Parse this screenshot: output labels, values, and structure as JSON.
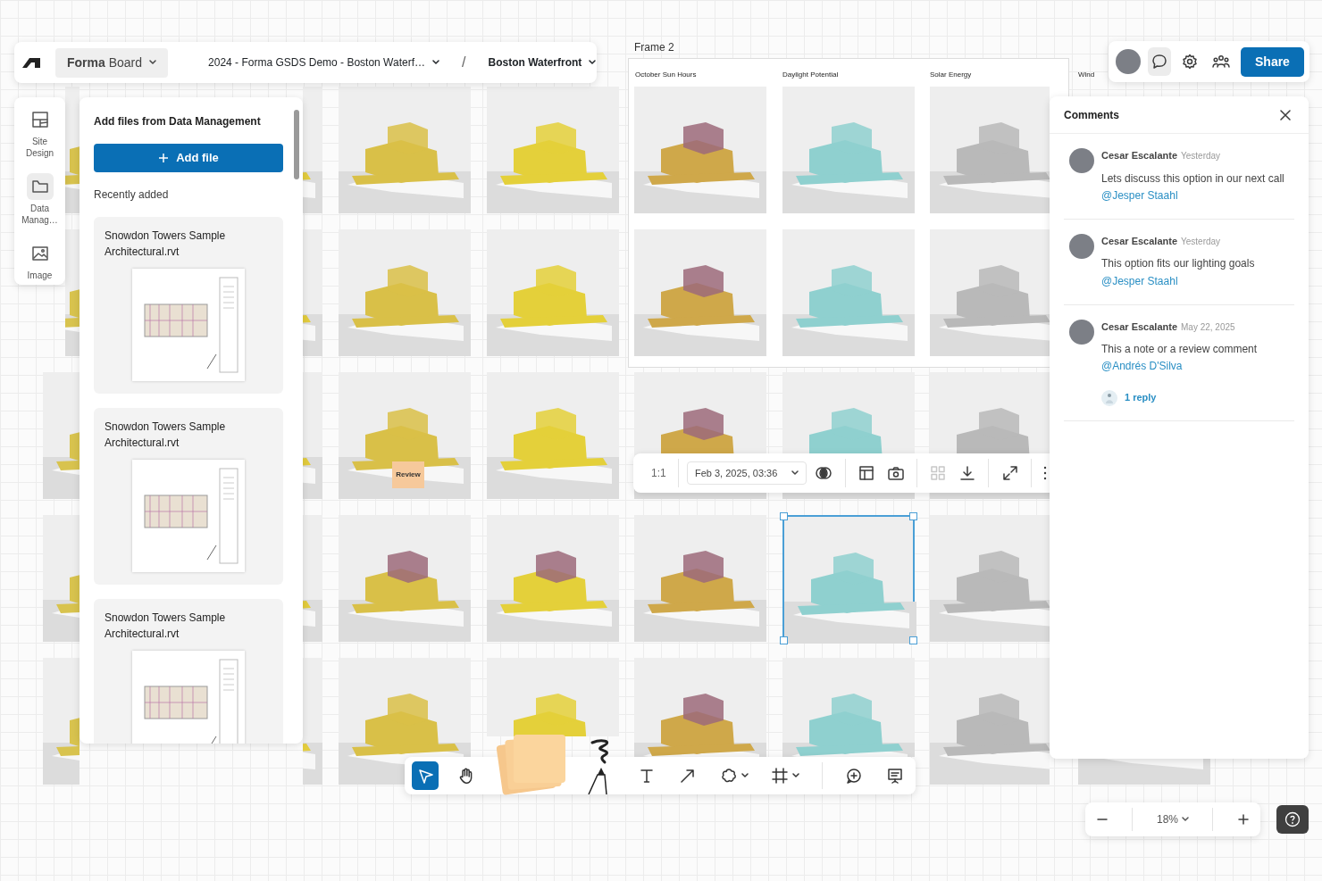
{
  "topbar": {
    "app_name": "**Forma** Board",
    "project": "2024 - Forma GSDS Demo - Boston Waterf…",
    "separator": "/",
    "site": "Boston Waterfront"
  },
  "top_actions": {
    "comments_open": true,
    "share_label": "Share"
  },
  "side_nav": [
    {
      "kind": "site",
      "label": "Site Design",
      "selected": false
    },
    {
      "kind": "folder",
      "label": "Data Manag…",
      "selected": true
    },
    {
      "kind": "image",
      "label": "Image",
      "selected": false
    }
  ],
  "files_panel": {
    "title": "Add files from Data Management",
    "add_button": "Add file",
    "section": "Recently added",
    "files": [
      {
        "name": "Snowdon Towers Sample Architectural.rvt"
      },
      {
        "name": "Snowdon Towers Sample Architectural.rvt"
      },
      {
        "name": "Snowdon Towers Sample Architectural.rvt"
      }
    ]
  },
  "canvas": {
    "frame_label": "Frame 2",
    "column_titles": [
      "October Sun Hours",
      "Daylight Potential",
      "Solar Energy",
      "Wind"
    ],
    "sticky_label": "Review",
    "tile_rows": [
      {
        "tiles": [
          {
            "selected": false
          },
          {
            "selected": false
          },
          {
            "selected": false
          },
          {
            "selected": false
          },
          {
            "selected": false
          },
          {
            "selected": false
          },
          {
            "selected": false
          }
        ]
      },
      {
        "tiles": [
          {
            "selected": false
          },
          {
            "selected": false
          },
          {
            "selected": false
          },
          {
            "selected": false
          },
          {
            "selected": false
          },
          {
            "selected": false
          },
          {
            "selected": false
          }
        ]
      },
      {
        "tiles": [
          {
            "selected": false
          },
          {
            "selected": false
          },
          {
            "selected": false
          },
          {
            "selected": false
          },
          {
            "selected": false
          },
          {
            "selected": false
          },
          {
            "selected": false
          }
        ]
      },
      {
        "tiles": [
          {
            "selected": false
          },
          {
            "selected": false
          },
          {
            "selected": false
          },
          {
            "selected": false
          },
          {
            "selected": false
          },
          {
            "selected": true
          },
          {
            "selected": false
          }
        ]
      },
      {
        "tiles": [
          {
            "selected": false
          },
          {
            "selected": false
          },
          {
            "selected": false
          },
          {
            "selected": false
          },
          {
            "selected": false
          },
          {
            "selected": false
          },
          {
            "selected": false
          },
          {
            "selected": false
          }
        ]
      }
    ]
  },
  "image_toolbar": {
    "scale": "1:1",
    "date": "Feb 3, 2025, 03:36",
    "tools": [
      {
        "kind": "contrast",
        "disabled": false
      },
      {
        "kind": "layout",
        "disabled": false
      },
      {
        "kind": "camera",
        "disabled": false
      },
      {
        "kind": "grid",
        "disabled": true
      },
      {
        "kind": "download",
        "disabled": false
      },
      {
        "kind": "expand",
        "disabled": false
      },
      {
        "kind": "more",
        "disabled": false
      }
    ]
  },
  "comments": {
    "title": "Comments",
    "items": [
      {
        "author": "Cesar Escalante",
        "time": "Yesterday",
        "text": "Lets discuss this option in our next call",
        "mention": "@Jesper Staahl"
      },
      {
        "author": "Cesar Escalante",
        "time": "Yesterday",
        "text": "This option fits our lighting goals",
        "mention": "@Jesper Staahl"
      },
      {
        "author": "Cesar Escalante",
        "time": "May 22, 2025",
        "text": "This a note or a review comment",
        "mention": "@Andrés D'Silva",
        "reply": "1 reply"
      }
    ]
  },
  "tools": [
    {
      "kind": "select",
      "selected": true
    },
    {
      "kind": "hand",
      "selected": false
    },
    {
      "kind": "sticky",
      "selected": false
    },
    {
      "kind": "pen",
      "selected": false
    },
    {
      "kind": "text",
      "selected": false
    },
    {
      "kind": "arrow",
      "selected": false
    },
    {
      "kind": "shape",
      "selected": false
    },
    {
      "kind": "frame",
      "selected": false
    },
    {
      "kind": "comment",
      "selected": false
    },
    {
      "kind": "present",
      "selected": false
    }
  ],
  "zoom": {
    "level_text": "18%"
  }
}
